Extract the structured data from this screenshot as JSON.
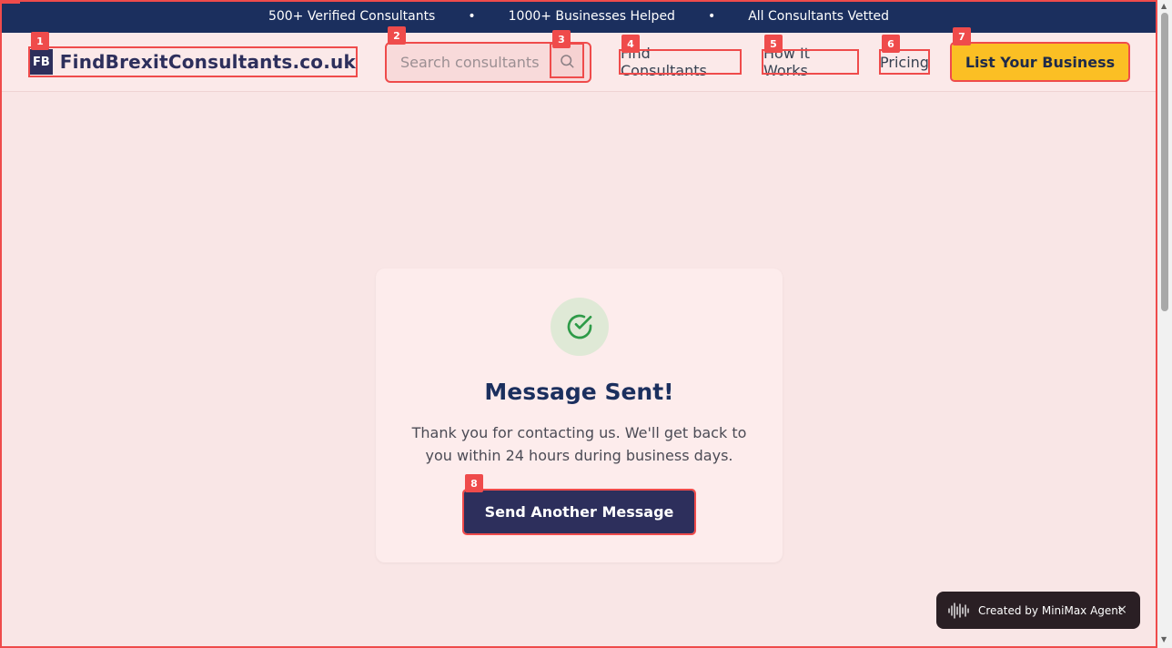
{
  "topbar": {
    "stat1": "500+ Verified Consultants",
    "sep": "•",
    "stat2": "1000+ Businesses Helped",
    "stat3": "All Consultants Vetted"
  },
  "header": {
    "logo_abbr": "FB",
    "logo_text": "FindBrexitConsultants.co.uk",
    "search_placeholder": "Search consultants",
    "nav": {
      "find": "Find Consultants",
      "how": "How It Works",
      "pricing": "Pricing"
    },
    "cta": "List Your Business"
  },
  "badges": [
    "1",
    "2",
    "3",
    "4",
    "5",
    "6",
    "7",
    "8"
  ],
  "card": {
    "title": "Message Sent!",
    "message": "Thank you for contacting us. We'll get back to you within 24 hours during business days.",
    "button": "Send Another Message"
  },
  "toast": {
    "text": "Created by MiniMax Agent",
    "close": "×"
  },
  "colors": {
    "navy": "#1b2f5e",
    "brand": "#2d2f5c",
    "accent": "#fbbf24",
    "marker": "#ef4b4b",
    "success": "#2e9b48"
  },
  "icons": {
    "search": "search-icon",
    "check": "check-circle-icon",
    "wave": "waveform-icon",
    "close": "close-icon"
  }
}
